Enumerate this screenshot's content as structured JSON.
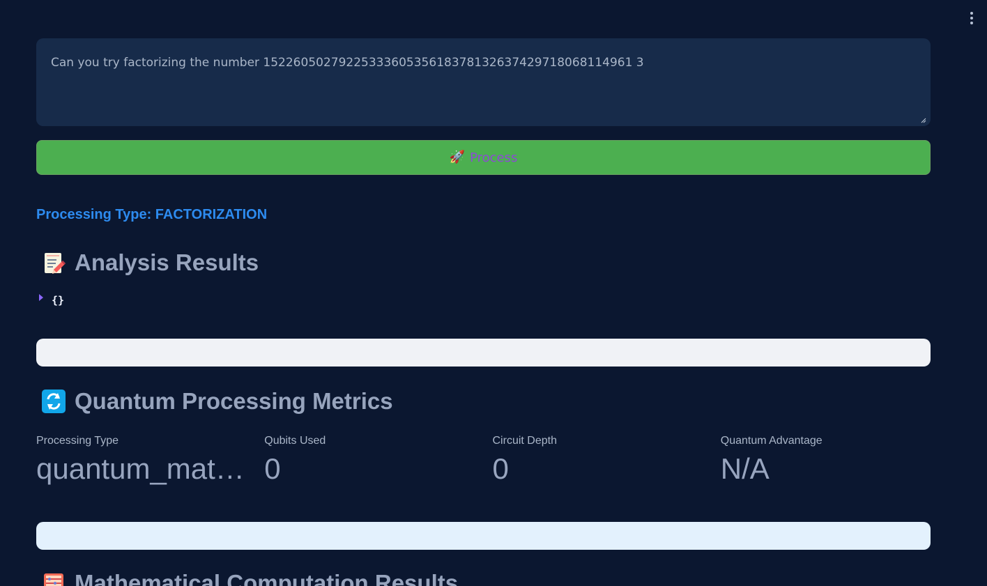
{
  "header": {
    "menu_icon": "more-vertical-icon"
  },
  "query": {
    "text": "Can you try factorizing the number 1522605027922533360535618378132637429718068114961 3"
  },
  "process_button": {
    "icon": "rocket-icon",
    "label": "Process",
    "background": "#4caf50",
    "label_color": "#8c4bd5"
  },
  "processing_type": {
    "text": "Processing Type: FACTORIZATION",
    "color": "#2d8bef"
  },
  "analysis": {
    "icon": "memo-icon",
    "title": "Analysis Results",
    "json_preview": "{}"
  },
  "metrics": {
    "icon": "refresh-icon",
    "title": "Quantum Processing Metrics",
    "items": [
      {
        "label": "Processing Type",
        "value": "quantum_mathematical"
      },
      {
        "label": "Qubits Used",
        "value": "0"
      },
      {
        "label": "Circuit Depth",
        "value": "0"
      },
      {
        "label": "Quantum Advantage",
        "value": "N/A"
      }
    ]
  },
  "math_results": {
    "icon": "abacus-icon",
    "title": "Mathematical Computation Results"
  },
  "colors": {
    "page_background": "#0b1730",
    "input_background": "#172b4a",
    "heading_text": "#97a4bd",
    "empty_box_one": "#f0f2f6",
    "empty_box_two": "#e3f1fd"
  }
}
